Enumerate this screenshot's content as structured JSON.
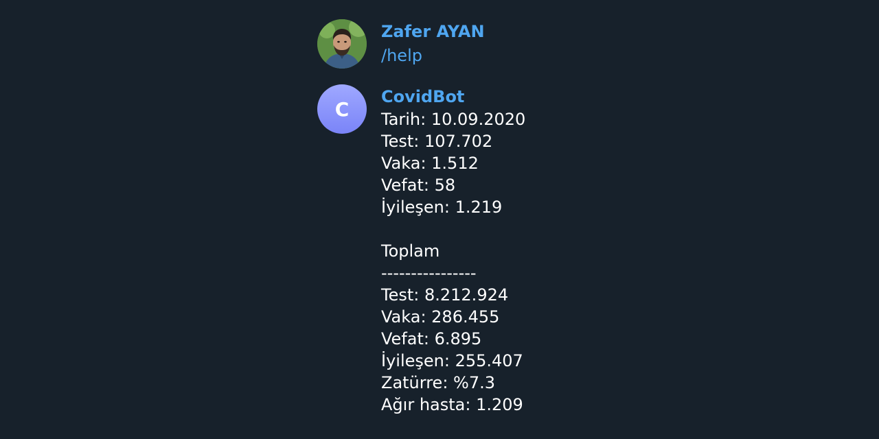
{
  "messages": [
    {
      "author": "Zafer AYAN",
      "avatar": {
        "type": "photo",
        "icon": "user-photo-avatar"
      },
      "lines": [
        "/help"
      ]
    },
    {
      "author": "CovidBot",
      "avatar": {
        "type": "letter",
        "letter": "C",
        "color": "#8b93fa"
      },
      "lines": [
        "Tarih: 10.09.2020",
        "Test: 107.702",
        "Vaka: 1.512",
        "Vefat: 58",
        "İyileşen: 1.219",
        "",
        "Toplam",
        "----------------",
        "Test: 8.212.924",
        "Vaka: 286.455",
        "Vefat: 6.895",
        "İyileşen: 255.407",
        "Zatürre: %7.3",
        "Ağır hasta: 1.209"
      ]
    }
  ],
  "colors": {
    "background": "#17212b",
    "author_name": "#4fa6f0",
    "link": "#4fa6f0",
    "text": "#ffffff"
  }
}
